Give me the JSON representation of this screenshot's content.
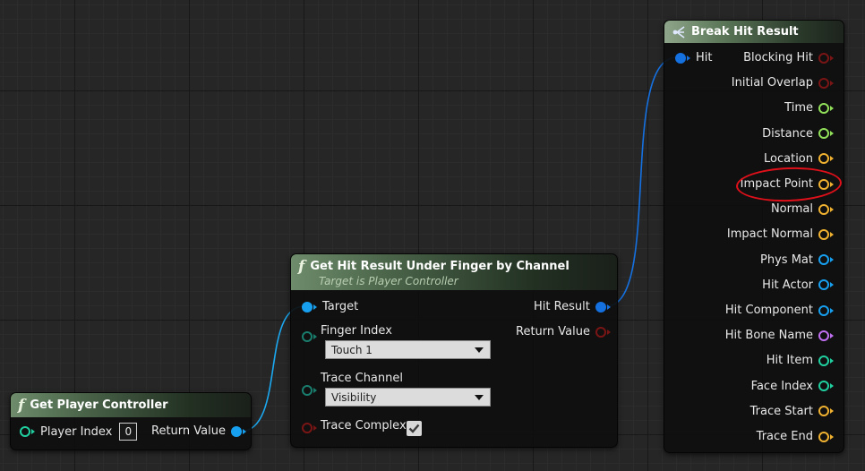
{
  "colors": {
    "exec_blue": "#1e90ff",
    "struct_blue": "#1570e0",
    "bool_red": "#7a1515",
    "float_green": "#92e05a",
    "vector_gold": "#f0b230",
    "object_blue": "#18a0f0",
    "int_teal": "#20d0a0",
    "name_purple": "#c070f0",
    "channel_teal": "#1a7e6e",
    "annotation_red": "#e0101a"
  },
  "nodes": {
    "get_player_controller": {
      "title": "Get Player Controller",
      "pins": {
        "player_index_label": "Player Index",
        "player_index_value": "0",
        "return_value_label": "Return Value"
      }
    },
    "get_hit_result": {
      "title": "Get Hit Result Under Finger by Channel",
      "subtitle": "Target is Player Controller",
      "pins": {
        "target": "Target",
        "finger_index_label": "Finger Index",
        "finger_index_value": "Touch 1",
        "trace_channel_label": "Trace Channel",
        "trace_channel_value": "Visibility",
        "trace_complex_label": "Trace Complex",
        "trace_complex_checked": true,
        "hit_result": "Hit Result",
        "return_value": "Return Value"
      }
    },
    "break_hit_result": {
      "title": "Break Hit Result",
      "input_label": "Hit",
      "outputs": [
        {
          "label": "Blocking Hit",
          "kind": "bool"
        },
        {
          "label": "Initial Overlap",
          "kind": "bool"
        },
        {
          "label": "Time",
          "kind": "float"
        },
        {
          "label": "Distance",
          "kind": "float"
        },
        {
          "label": "Location",
          "kind": "vector"
        },
        {
          "label": "Impact Point",
          "kind": "vector"
        },
        {
          "label": "Normal",
          "kind": "vector"
        },
        {
          "label": "Impact Normal",
          "kind": "vector"
        },
        {
          "label": "Phys Mat",
          "kind": "object"
        },
        {
          "label": "Hit Actor",
          "kind": "object"
        },
        {
          "label": "Hit Component",
          "kind": "object"
        },
        {
          "label": "Hit Bone Name",
          "kind": "name"
        },
        {
          "label": "Hit Item",
          "kind": "int"
        },
        {
          "label": "Face Index",
          "kind": "int"
        },
        {
          "label": "Trace Start",
          "kind": "vector"
        },
        {
          "label": "Trace End",
          "kind": "vector"
        }
      ]
    }
  },
  "annotation": {
    "target": "Impact Point",
    "shape": "ellipse"
  }
}
